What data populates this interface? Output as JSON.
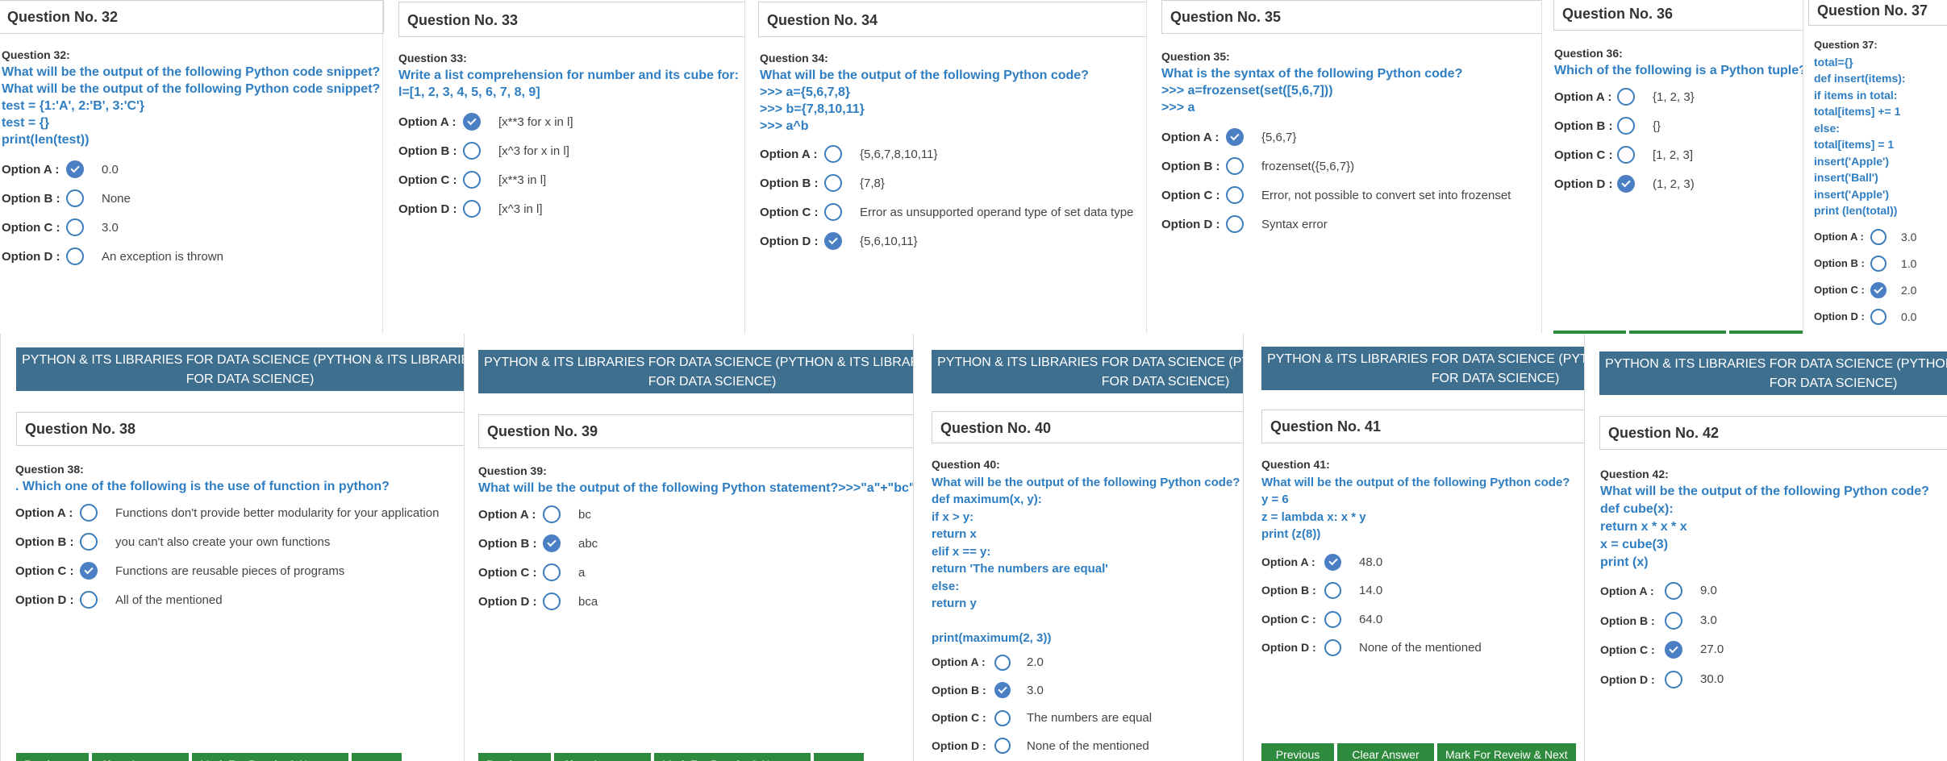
{
  "banner_title": "PYTHON & ITS LIBRARIES FOR DATA SCIENCE (PYTHON & ITS LIBRARIES FOR DATA SCIENCE)",
  "buttons": {
    "previous": "Previous",
    "clear": "Clear Answer",
    "review": "Mark For Reveiw & Next"
  },
  "q32": {
    "header": "Question No. 32",
    "label": "Question 32:",
    "text": "What will be the output of the following Python code snippet?\nWhat will be the output of the following Python code snippet?\ntest = {1:'A', 2:'B', 3:'C'}\ntest = {}\nprint(len(test))",
    "options": [
      {
        "label": "Option A :",
        "text": "0.0",
        "checked": true
      },
      {
        "label": "Option B :",
        "text": "None",
        "checked": false
      },
      {
        "label": "Option C :",
        "text": "3.0",
        "checked": false
      },
      {
        "label": "Option D :",
        "text": "An exception is thrown",
        "checked": false
      }
    ]
  },
  "q33": {
    "header": "Question No. 33",
    "label": "Question 33:",
    "text": "Write a list comprehension for number and its cube for:\nl=[1, 2, 3, 4, 5, 6, 7, 8, 9]",
    "options": [
      {
        "label": "Option A :",
        "text": "[x**3 for x in l]",
        "checked": true
      },
      {
        "label": "Option B :",
        "text": "[x^3 for x in l]",
        "checked": false
      },
      {
        "label": "Option C :",
        "text": "[x**3 in l]",
        "checked": false
      },
      {
        "label": "Option D :",
        "text": "[x^3 in l]",
        "checked": false
      }
    ]
  },
  "q34": {
    "header": "Question No. 34",
    "label": "Question 34:",
    "text": "What will be the output of the following Python code?\n>>> a={5,6,7,8}\n>>> b={7,8,10,11}\n>>> a^b",
    "options": [
      {
        "label": "Option A :",
        "text": "{5,6,7,8,10,11}",
        "checked": false
      },
      {
        "label": "Option B :",
        "text": "{7,8}",
        "checked": false
      },
      {
        "label": "Option C :",
        "text": "Error as unsupported operand type of set data type",
        "checked": false
      },
      {
        "label": "Option D :",
        "text": "{5,6,10,11}",
        "checked": true
      }
    ]
  },
  "q35": {
    "header": "Question No. 35",
    "label": "Question 35:",
    "text": "What is the syntax of the following Python code?\n>>> a=frozenset(set([5,6,7]))\n>>> a",
    "options": [
      {
        "label": "Option A :",
        "text": "{5,6,7}",
        "checked": true
      },
      {
        "label": "Option B :",
        "text": "frozenset({5,6,7})",
        "checked": false
      },
      {
        "label": "Option C :",
        "text": "Error, not possible to convert set into frozenset",
        "checked": false
      },
      {
        "label": "Option D :",
        "text": "Syntax error",
        "checked": false
      }
    ]
  },
  "q36": {
    "header": "Question No. 36",
    "label": "Question 36:",
    "text": "Which of the following is a Python tuple?",
    "options": [
      {
        "label": "Option A :",
        "text": "{1, 2, 3}",
        "checked": false
      },
      {
        "label": "Option B :",
        "text": "{}",
        "checked": false
      },
      {
        "label": "Option C :",
        "text": "[1, 2, 3]",
        "checked": false
      },
      {
        "label": "Option D :",
        "text": "(1, 2, 3)",
        "checked": true
      }
    ]
  },
  "q37": {
    "header": "Question No. 37",
    "label": "Question 37:",
    "text": "total={}\ndef insert(items):\nif items in total:\ntotal[items] += 1\nelse:\ntotal[items] = 1\ninsert('Apple')\ninsert('Ball')\ninsert('Apple')\nprint (len(total))",
    "options": [
      {
        "label": "Option A :",
        "text": "3.0",
        "checked": false
      },
      {
        "label": "Option B :",
        "text": "1.0",
        "checked": false
      },
      {
        "label": "Option C :",
        "text": "2.0",
        "checked": true
      },
      {
        "label": "Option D :",
        "text": "0.0",
        "checked": false
      }
    ]
  },
  "q38": {
    "header": "Question No. 38",
    "label": "Question 38:",
    "text": ". Which one of the following is the use of function in python?",
    "options": [
      {
        "label": "Option A :",
        "text": "Functions don't provide better modularity for your application",
        "checked": false
      },
      {
        "label": "Option B :",
        "text": "you can't also create your own functions",
        "checked": false
      },
      {
        "label": "Option C :",
        "text": "Functions are reusable pieces of programs",
        "checked": true
      },
      {
        "label": "Option D :",
        "text": "All of the mentioned",
        "checked": false
      }
    ]
  },
  "q39": {
    "header": "Question No. 39",
    "label": "Question 39:",
    "text": "What will be the output of the following Python statement?>>>\"a\"+\"bc\"",
    "options": [
      {
        "label": "Option A :",
        "text": "bc",
        "checked": false
      },
      {
        "label": "Option B :",
        "text": "abc",
        "checked": true
      },
      {
        "label": "Option C :",
        "text": "a",
        "checked": false
      },
      {
        "label": "Option D :",
        "text": "bca",
        "checked": false
      }
    ]
  },
  "q40": {
    "header": "Question No. 40",
    "label": "Question 40:",
    "text": "What will be the output of the following Python code?\ndef maximum(x, y):\nif x > y:\nreturn x\nelif x == y:\nreturn 'The numbers are equal'\nelse:\nreturn y\n\nprint(maximum(2, 3))",
    "options": [
      {
        "label": "Option A :",
        "text": "2.0",
        "checked": false
      },
      {
        "label": "Option B :",
        "text": "3.0",
        "checked": true
      },
      {
        "label": "Option C :",
        "text": "The numbers are equal",
        "checked": false
      },
      {
        "label": "Option D :",
        "text": "None of the mentioned",
        "checked": false
      }
    ]
  },
  "q41": {
    "header": "Question No. 41",
    "label": "Question 41:",
    "text": "What will be the output of the following Python code?\ny = 6\nz = lambda x: x * y\nprint (z(8))",
    "options": [
      {
        "label": "Option A :",
        "text": "48.0",
        "checked": true
      },
      {
        "label": "Option B :",
        "text": "14.0",
        "checked": false
      },
      {
        "label": "Option C :",
        "text": "64.0",
        "checked": false
      },
      {
        "label": "Option D :",
        "text": "None of the mentioned",
        "checked": false
      }
    ]
  },
  "q42": {
    "header": "Question No. 42",
    "label": "Question 42:",
    "text": "What will be the output of the following Python code?\ndef cube(x):\nreturn x * x * x\nx = cube(3)\nprint (x)",
    "options": [
      {
        "label": "Option A :",
        "text": "9.0",
        "checked": false
      },
      {
        "label": "Option B :",
        "text": "3.0",
        "checked": false
      },
      {
        "label": "Option C :",
        "text": "27.0",
        "checked": true
      },
      {
        "label": "Option D :",
        "text": "30.0",
        "checked": false
      }
    ]
  }
}
